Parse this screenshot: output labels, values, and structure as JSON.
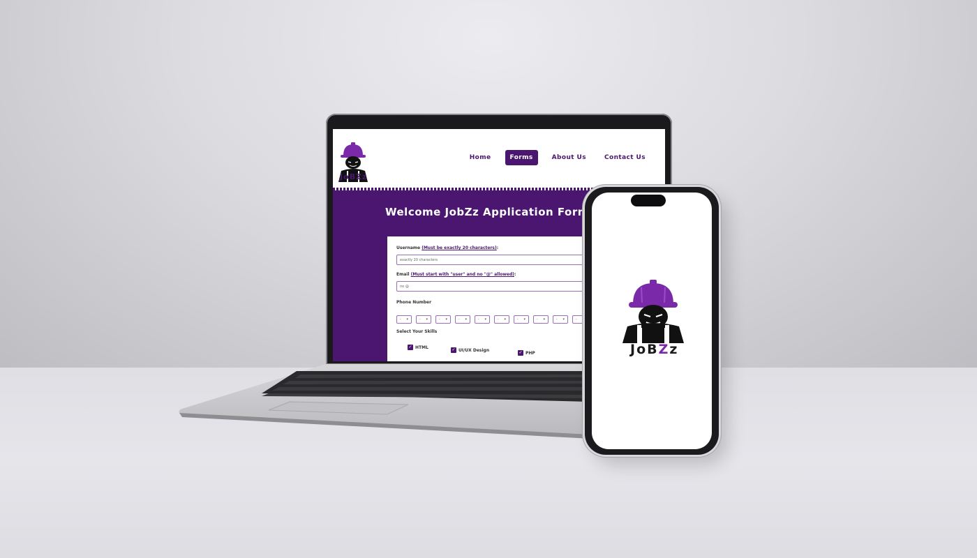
{
  "colors": {
    "brand_purple": "#4b1670",
    "accent_purple": "#7a2aa8",
    "white": "#ffffff"
  },
  "site": {
    "logo_text": "JoBZz",
    "nav": [
      {
        "label": "Home",
        "active": false
      },
      {
        "label": "Forms",
        "active": true
      },
      {
        "label": "About Us",
        "active": false
      },
      {
        "label": "Contact Us",
        "active": false
      }
    ],
    "title": "Welcome JobZz Application Form",
    "form": {
      "username_label": "Username",
      "username_hint": "(Must be exactly 20 characters)",
      "username_placeholder": "exactly 20 characters",
      "email_label": "Email",
      "email_hint": "(Must start with \"user\" and no \"@\" allowed)",
      "email_placeholder": "no @",
      "phone_label": "Phone Number",
      "phone_selects": [
        "-",
        "-",
        "-",
        "-",
        "-",
        "-",
        "-",
        "-",
        "-",
        "-"
      ],
      "skills_label": "Select Your Skills",
      "skills": [
        {
          "label": "HTML",
          "checked": true
        },
        {
          "label": "UI/UX Design",
          "checked": true
        },
        {
          "label": "PHP",
          "checked": true
        }
      ]
    }
  },
  "phone_app": {
    "logo_text_prefix": "JoB",
    "logo_text_accent": "Z",
    "logo_text_suffix": "z"
  }
}
